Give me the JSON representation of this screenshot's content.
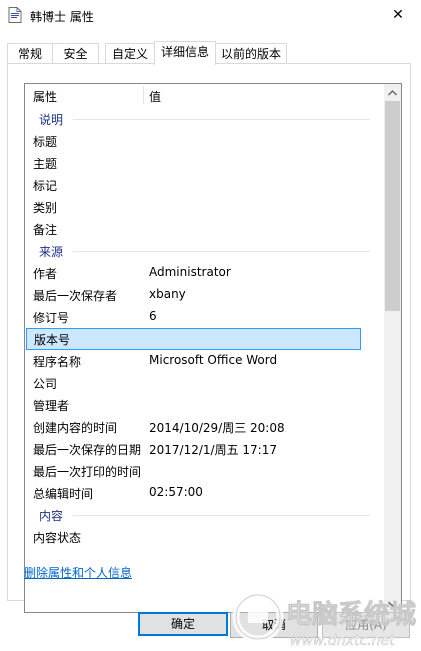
{
  "window": {
    "title": "韩博士 属性",
    "close_symbol": "✕"
  },
  "tabs": [
    {
      "label": "常规",
      "active": false
    },
    {
      "label": "安全",
      "active": false
    },
    {
      "label": "自定义",
      "active": false
    },
    {
      "label": "详细信息",
      "active": true
    },
    {
      "label": "以前的版本",
      "active": false
    }
  ],
  "list": {
    "header": {
      "property": "属性",
      "value": "值"
    },
    "rows": [
      {
        "type": "group",
        "label": "说明"
      },
      {
        "type": "item",
        "key": "标题",
        "value": ""
      },
      {
        "type": "item",
        "key": "主题",
        "value": ""
      },
      {
        "type": "item",
        "key": "标记",
        "value": ""
      },
      {
        "type": "item",
        "key": "类别",
        "value": ""
      },
      {
        "type": "item",
        "key": "备注",
        "value": ""
      },
      {
        "type": "group",
        "label": "来源"
      },
      {
        "type": "item",
        "key": "作者",
        "value": "Administrator"
      },
      {
        "type": "item",
        "key": "最后一次保存者",
        "value": "xbany"
      },
      {
        "type": "item",
        "key": "修订号",
        "value": "6"
      },
      {
        "type": "item",
        "key": "版本号",
        "value": "",
        "selected": true
      },
      {
        "type": "item",
        "key": "程序名称",
        "value": "Microsoft Office Word"
      },
      {
        "type": "item",
        "key": "公司",
        "value": ""
      },
      {
        "type": "item",
        "key": "管理者",
        "value": ""
      },
      {
        "type": "item",
        "key": "创建内容的时间",
        "value": "2014/10/29/周三 20:08"
      },
      {
        "type": "item",
        "key": "最后一次保存的日期",
        "value": "2017/12/1/周五 17:17"
      },
      {
        "type": "item",
        "key": "最后一次打印的时间",
        "value": ""
      },
      {
        "type": "item",
        "key": "总编辑时间",
        "value": "02:57:00"
      },
      {
        "type": "group",
        "label": "内容"
      },
      {
        "type": "item",
        "key": "内容状态",
        "value": ""
      }
    ]
  },
  "link": {
    "remove_properties": "删除属性和个人信息"
  },
  "buttons": {
    "ok": "确定",
    "cancel": "取消",
    "apply": "应用(A)"
  },
  "watermark": {
    "text": "电脑系统城",
    "url": "www.dnxtc.net"
  },
  "colors": {
    "selection_bg": "#cce8ff",
    "selection_border": "#3399ff",
    "link": "#0066cc",
    "group_label": "#1e3287",
    "default_button_border": "#0078d7"
  }
}
